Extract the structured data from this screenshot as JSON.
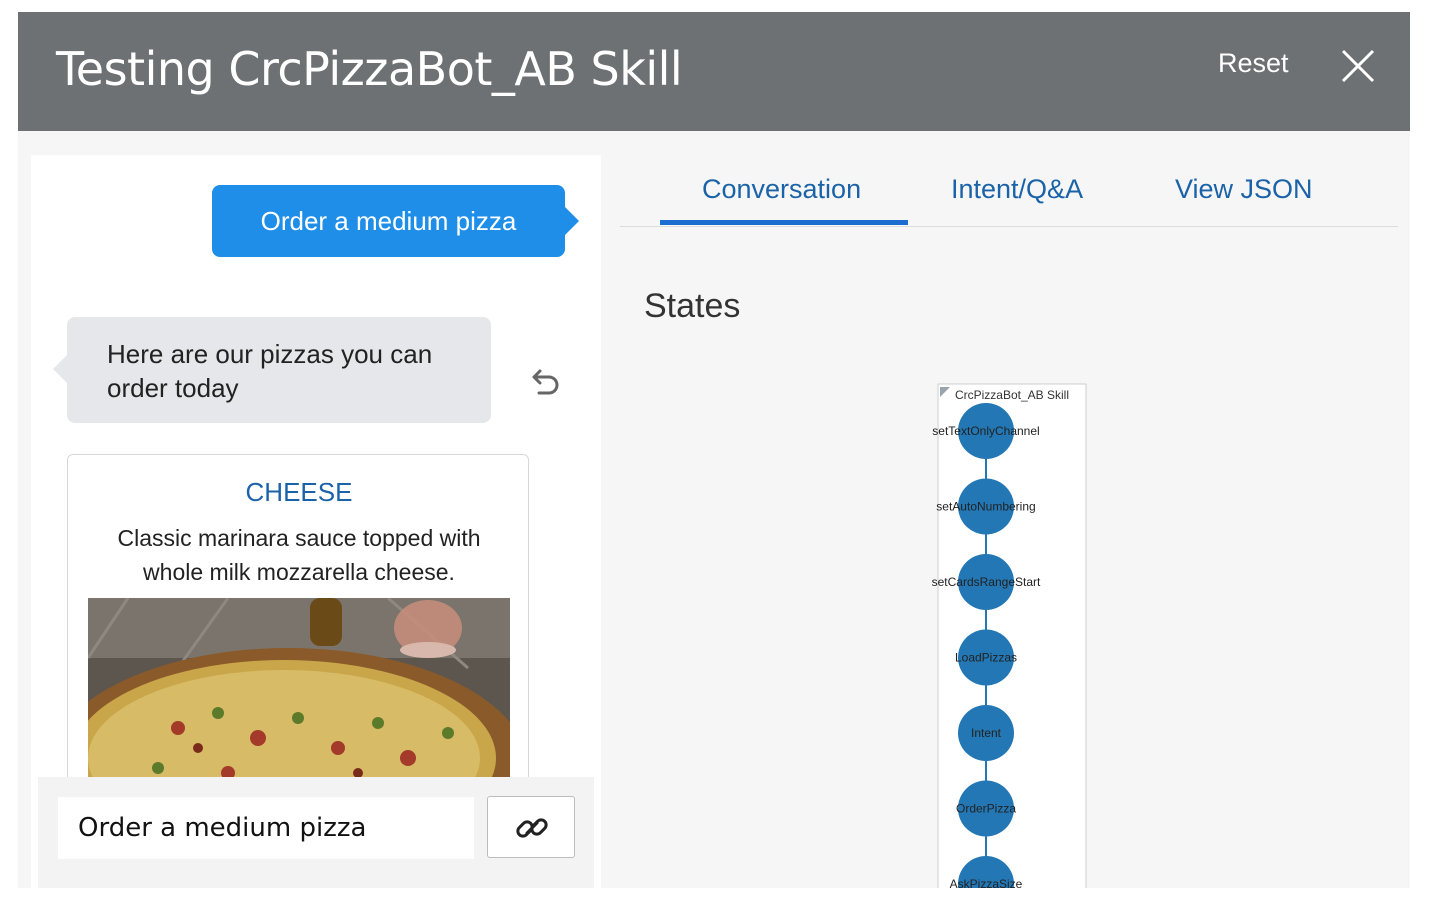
{
  "window": {
    "title": "Testing CrcPizzaBot_AB Skill",
    "reset_label": "Reset",
    "close_icon": "close-icon"
  },
  "chat": {
    "user_message": "Order a medium pizza",
    "bot_message": "Here are our pizzas you can order today",
    "reply_icon": "reply-icon",
    "card": {
      "title": "CHEESE",
      "description": "Classic marinara sauce topped with whole milk mozzarella cheese.",
      "image": "pizza-photo"
    },
    "input": {
      "value": "Order a medium pizza",
      "attach_icon": "link-icon"
    }
  },
  "tabs": [
    {
      "label": "Conversation",
      "active": true
    },
    {
      "label": "Intent/Q&A",
      "active": false
    },
    {
      "label": "View JSON",
      "active": false
    }
  ],
  "states": {
    "heading": "States",
    "graph_title": "CrcPizzaBot_AB Skill",
    "node_color": "#2277b4",
    "nodes": [
      "setTextOnlyChannel",
      "setAutoNumbering",
      "setCardsRangeStart",
      "LoadPizzas",
      "Intent",
      "OrderPizza",
      "AskPizzaSize"
    ]
  }
}
